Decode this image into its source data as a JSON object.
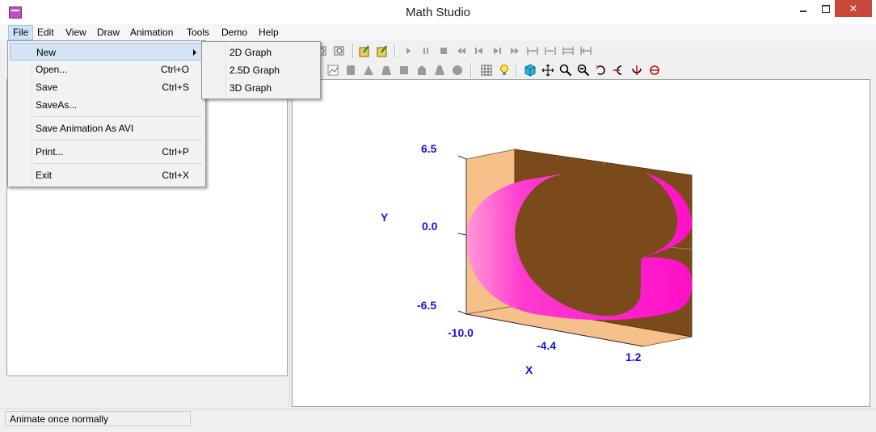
{
  "window": {
    "title": "Math Studio"
  },
  "menubar": [
    "File",
    "Edit",
    "View",
    "Draw",
    "Animation",
    "Tools",
    "Demo",
    "Help"
  ],
  "file_menu": {
    "items": [
      {
        "label": "New",
        "shortcut": ""
      },
      {
        "label": "Open...",
        "shortcut": "Ctrl+O"
      },
      {
        "label": "Save",
        "shortcut": "Ctrl+S"
      },
      {
        "label": "SaveAs...",
        "shortcut": ""
      },
      {
        "label": "Save Animation As AVI",
        "shortcut": ""
      },
      {
        "label": "Print...",
        "shortcut": "Ctrl+P"
      },
      {
        "label": "Exit",
        "shortcut": "Ctrl+X"
      }
    ]
  },
  "new_submenu": [
    "2D Graph",
    "2.5D Graph",
    "3D Graph"
  ],
  "graph": {
    "y_axis_label": "Y",
    "x_axis_label": "X",
    "y_ticks": [
      "6.5",
      "0.0",
      "-6.5"
    ],
    "x_ticks": [
      "-10.0",
      "-4.4",
      "1.2"
    ],
    "colors": {
      "surface": "#ff2ad4",
      "back_wall": "#7a4a1a",
      "side_wall": "#f5c08a",
      "axis_text": "#1414e6"
    }
  },
  "status": {
    "text": "Animate once normally"
  }
}
